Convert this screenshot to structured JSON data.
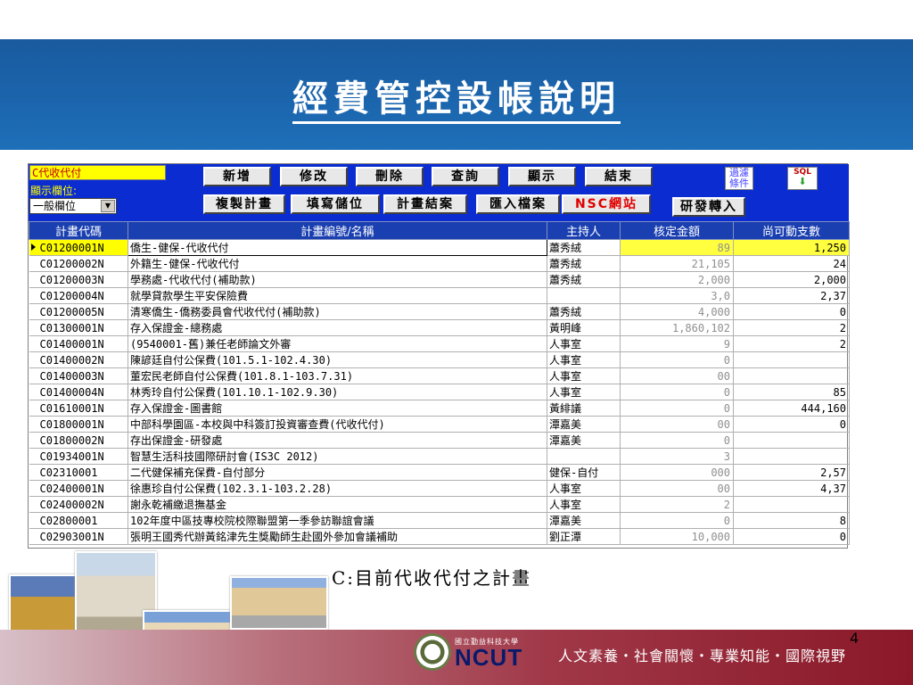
{
  "slide": {
    "title": "經費管控設帳說明",
    "caption": "C:目前代收代付之計畫",
    "slogan": "人文素養・社會關懷・專業知能・國際視野",
    "page_number": "4",
    "logo_text": "NCUT",
    "logo_subtext": "國立勤益科技大學"
  },
  "app": {
    "mode": "C代收代付",
    "display_field_label": "顯示欄位:",
    "display_field_value": "一般欄位",
    "buttons_row1": [
      "新增",
      "修改",
      "刪除",
      "查詢",
      "顯示",
      "結束"
    ],
    "buttons_row2": [
      "複製計畫",
      "填寫儲位",
      "計畫結案",
      "匯入檔案",
      "NSC網站",
      "研發轉入"
    ],
    "filter_label": "過濾條件",
    "sql_label": "SQL",
    "columns": [
      "計畫代碼",
      "計畫編號/名稱",
      "主持人",
      "核定金額",
      "尚可動支數"
    ],
    "rows": [
      {
        "code": "C01200001N",
        "name": "僑生-健保-代收代付",
        "pi": "蕭秀絨",
        "amount": "89",
        "balance": "1,250"
      },
      {
        "code": "C01200002N",
        "name": "外籍生-健保-代收代付",
        "pi": "蕭秀絨",
        "amount": "21,105",
        "balance": "24"
      },
      {
        "code": "C01200003N",
        "name": "學務處-代收代付(補助款)",
        "pi": "蕭秀絨",
        "amount": "2,000",
        "balance": "2,000"
      },
      {
        "code": "C01200004N",
        "name": "就學貸款學生平安保險費",
        "pi": "",
        "amount": "3,0",
        "balance": "2,37"
      },
      {
        "code": "C01200005N",
        "name": "清寒僑生-僑務委員會代收代付(補助款)",
        "pi": "蕭秀絨",
        "amount": "4,000",
        "balance": "0"
      },
      {
        "code": "C01300001N",
        "name": "存入保證金-總務處",
        "pi": "黃明峰",
        "amount": "1,860,102",
        "balance": "2"
      },
      {
        "code": "C01400001N",
        "name": "(9540001-舊)兼任老師論文外審",
        "pi": "人事室",
        "amount": "9",
        "balance": "2"
      },
      {
        "code": "C01400002N",
        "name": "陳諺廷自付公保費(101.5.1-102.4.30)",
        "pi": "人事室",
        "amount": "0",
        "balance": ""
      },
      {
        "code": "C01400003N",
        "name": "董宏民老師自付公保費(101.8.1-103.7.31)",
        "pi": "人事室",
        "amount": "00",
        "balance": ""
      },
      {
        "code": "C01400004N",
        "name": "林秀玲自付公保費(101.10.1-102.9.30)",
        "pi": "人事室",
        "amount": "0",
        "balance": "85"
      },
      {
        "code": "C01610001N",
        "name": "存入保證金-圖書館",
        "pi": "黃緋議",
        "amount": "0",
        "balance": "444,160"
      },
      {
        "code": "C01800001N",
        "name": "中部科學園區-本校與中科簽訂投資審查費(代收代付)",
        "pi": "潭嘉美",
        "amount": "00",
        "balance": "0"
      },
      {
        "code": "C01800002N",
        "name": "存出保證金-研發處",
        "pi": "潭嘉美",
        "amount": "0",
        "balance": ""
      },
      {
        "code": "C01934001N",
        "name": "智慧生活科技國際研討會(IS3C 2012)",
        "pi": "",
        "amount": "3",
        "balance": ""
      },
      {
        "code": "C02310001",
        "name": "二代健保補充保費-自付部分",
        "pi": "健保-自付",
        "amount": "000",
        "balance": "2,57"
      },
      {
        "code": "C02400001N",
        "name": "徐惠珍自付公保費(102.3.1-103.2.28)",
        "pi": "人事室",
        "amount": "00",
        "balance": "4,37"
      },
      {
        "code": "C02400002N",
        "name": "謝永乾補繳退撫基金",
        "pi": "人事室",
        "amount": "2",
        "balance": ""
      },
      {
        "code": "C02800001",
        "name": "102年度中區技專校院校際聯盟第一季參訪聯誼會議",
        "pi": "潭嘉美",
        "amount": "0",
        "balance": "8"
      },
      {
        "code": "C02903001N",
        "name": "張明王國秀代辦黃銘津先生獎勵師生赴國外參加會議補助",
        "pi": "劉正潭",
        "amount": "10,000",
        "balance": "0"
      }
    ]
  }
}
